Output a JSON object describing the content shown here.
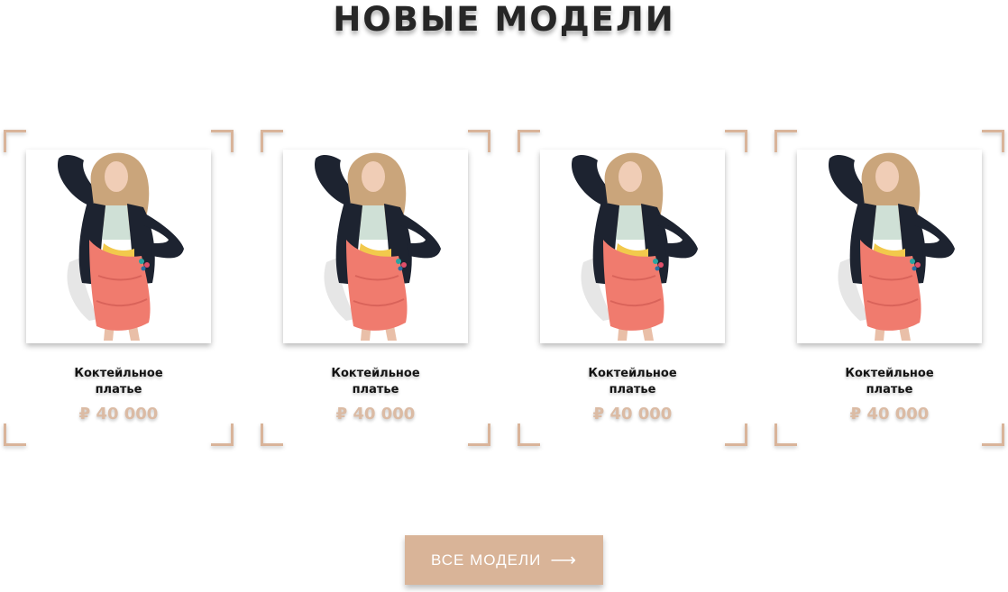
{
  "section": {
    "title": "НОВЫЕ МОДЕЛИ"
  },
  "products": [
    {
      "name_line1": "Коктейльное",
      "name_line2": "платье",
      "price": "₽ 40 000"
    },
    {
      "name_line1": "Коктейльное",
      "name_line2": "платье",
      "price": "₽ 40 000"
    },
    {
      "name_line1": "Коктейльное",
      "name_line2": "платье",
      "price": "₽ 40 000"
    },
    {
      "name_line1": "Коктейльное",
      "name_line2": "платье",
      "price": "₽ 40 000"
    }
  ],
  "cta": {
    "label": "ВСЕ МОДЕЛИ",
    "icon": "arrow-right-icon"
  },
  "colors": {
    "accent": "#d9b498",
    "price": "#dbbba4",
    "title": "#262626",
    "dress": "#f07b6e",
    "jacket": "#1d2330"
  }
}
